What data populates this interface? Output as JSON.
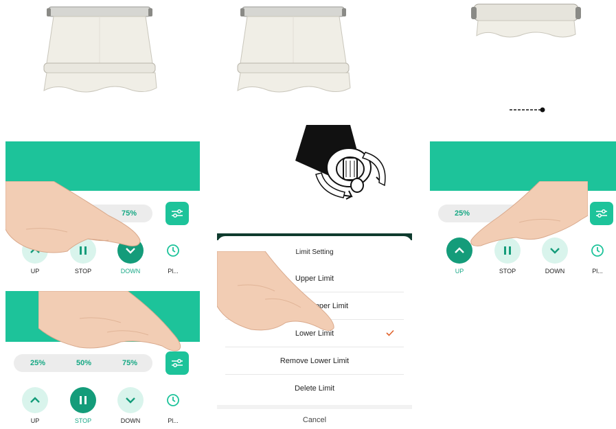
{
  "colors": {
    "accent": "#1dc39a",
    "accent_dark": "#149c7a",
    "check": "#e0622c"
  },
  "awnings": [
    {
      "state": "extended"
    },
    {
      "state": "extended"
    },
    {
      "state": "retracted"
    }
  ],
  "panel_down": {
    "percent": "75%",
    "controls": {
      "up": "UP",
      "stop": "STOP",
      "down": "DOWN",
      "plan": "Pl..."
    },
    "active": "down",
    "icons": {
      "up": "chevron-up-icon",
      "stop": "pause-icon",
      "down": "chevron-down-icon",
      "plan": "timer-icon",
      "settings": "sliders-icon"
    }
  },
  "panel_stop": {
    "percents": [
      "25%",
      "50%",
      "75%"
    ],
    "controls": {
      "up": "UP",
      "stop": "STOP",
      "down": "DOWN",
      "plan": "Pl..."
    },
    "active": "stop"
  },
  "panel_up": {
    "percent": "25%",
    "controls": {
      "up": "UP",
      "stop": "STOP",
      "down": "DOWN",
      "plan": "Pl..."
    },
    "active": "up"
  },
  "limit_sheet": {
    "title": "Limit Setting",
    "items": [
      "Upper Limit",
      "Remove Upper Limit",
      "Lower Limit",
      "Remove Lower Limit",
      "Delete Limit"
    ],
    "visible_items": [
      "Upper Limit",
      "Upper Limit",
      "Lower Limit",
      "Remove Lower Limit",
      "Delete Limit"
    ],
    "selected": "Lower Limit",
    "cancel": "Cancel"
  }
}
